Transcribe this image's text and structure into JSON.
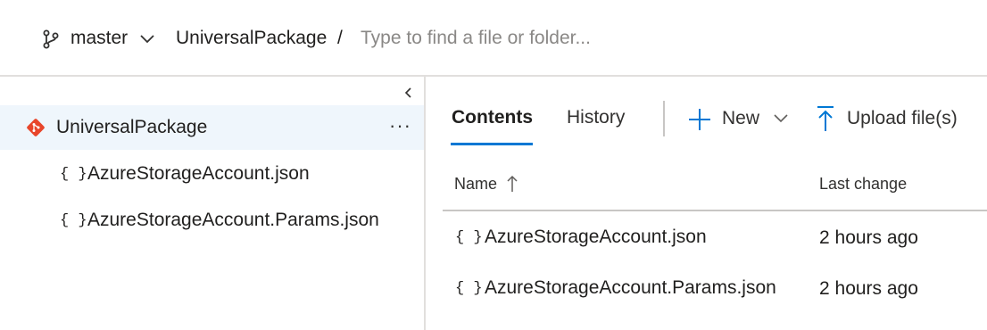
{
  "header": {
    "branch": "master",
    "repo": "UniversalPackage",
    "separator": "/",
    "search_placeholder": "Type to find a file or folder..."
  },
  "tree": {
    "root": "UniversalPackage",
    "more": "···",
    "file_icon_text": "{ }",
    "items": [
      {
        "label": "AzureStorageAccount.json"
      },
      {
        "label": "AzureStorageAccount.Params.json"
      }
    ]
  },
  "tabs": {
    "contents": "Contents",
    "history": "History"
  },
  "commands": {
    "new_label": "New",
    "upload_label": "Upload file(s)"
  },
  "grid": {
    "col_name": "Name",
    "col_last_change": "Last change",
    "file_icon_text": "{ }",
    "rows": [
      {
        "name": "AzureStorageAccount.json",
        "last_change": "2 hours ago"
      },
      {
        "name": "AzureStorageAccount.Params.json",
        "last_change": "2 hours ago"
      }
    ]
  },
  "colors": {
    "accent": "#0078d4",
    "git_icon": "#e8462b",
    "selected_row": "#eff6fc"
  }
}
